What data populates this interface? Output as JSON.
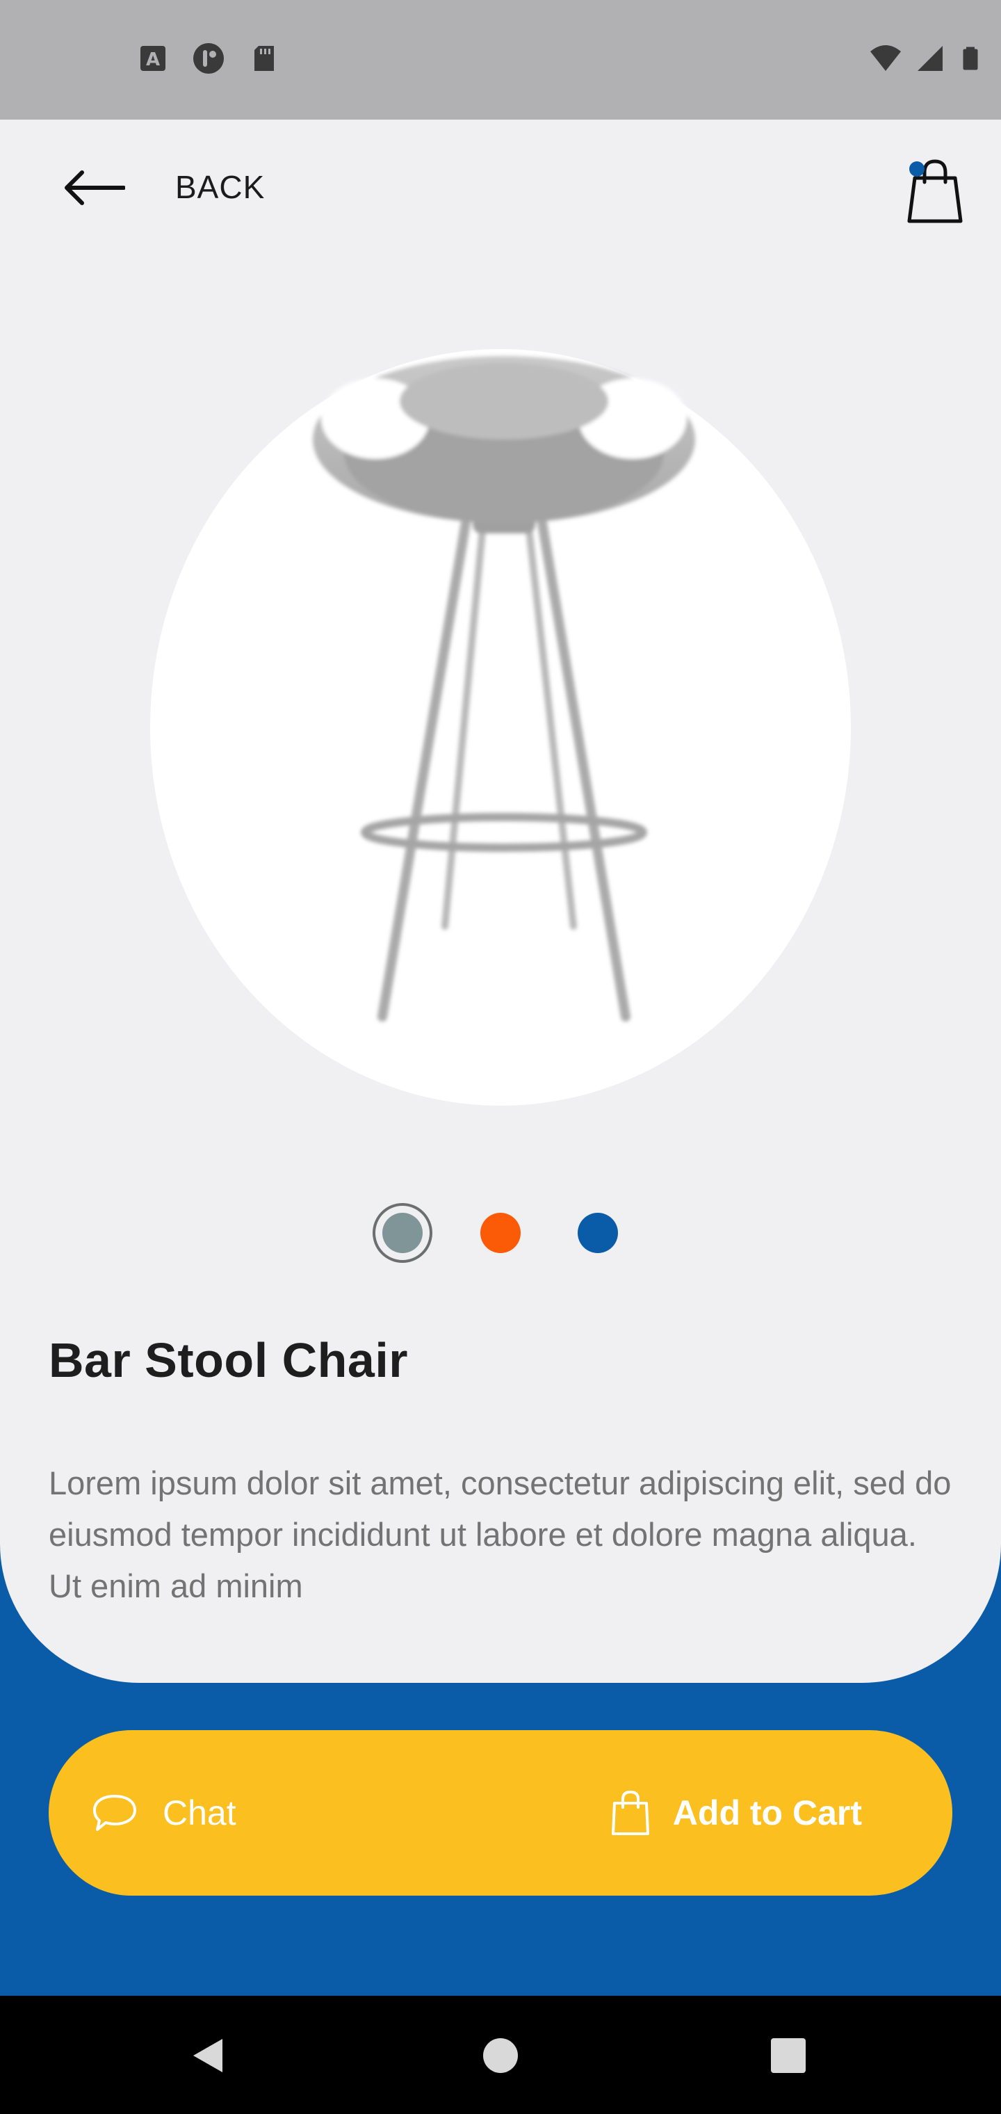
{
  "colors": {
    "brand_blue": "#0a5ca8",
    "accent_yellow": "#fbc01f",
    "card_bg": "#f0eff2",
    "status_bar_bg": "#b1b0b2"
  },
  "status_bar": {
    "left_icons": [
      "a-icon",
      "circle-app-icon",
      "sd-card-icon"
    ],
    "right_icons": [
      "wifi-icon",
      "signal-icon",
      "battery-icon"
    ]
  },
  "header": {
    "back_label": "BACK",
    "back_icon": "arrow-left-icon",
    "cart_icon": "shopping-bag-icon",
    "cart_badge_color": "#0a5ca8"
  },
  "product": {
    "name": "Bar Stool Chair",
    "description": "Lorem ipsum dolor sit amet, consectetur adipiscing elit, sed do eiusmod tempor incididunt ut labore et dolore magna aliqua. Ut enim ad minim",
    "colors": [
      {
        "name": "grey",
        "hex": "#7f9597",
        "selected": true
      },
      {
        "name": "orange",
        "hex": "#fb5a06",
        "selected": false
      },
      {
        "name": "blue",
        "hex": "#0a5ca8",
        "selected": false
      }
    ]
  },
  "actions": {
    "chat_label": "Chat",
    "chat_icon": "chat-bubble-icon",
    "add_to_cart_label": "Add to Cart",
    "add_to_cart_icon": "shopping-bag-icon"
  },
  "nav": {
    "icons": [
      "back-triangle-icon",
      "home-circle-icon",
      "recents-square-icon"
    ]
  }
}
